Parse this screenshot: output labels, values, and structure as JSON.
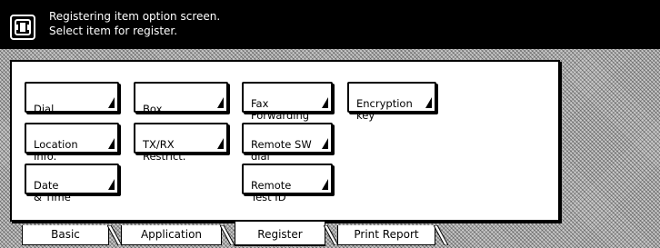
{
  "header": {
    "line1": "Registering item option screen.",
    "line2": "Select item for register.",
    "icon": "fax-machine-icon"
  },
  "buttons": {
    "dial": "Dial",
    "box": "Box",
    "fax_forwarding": "Fax\nForwarding",
    "encryption_key": "Encryption\nkey",
    "location_info": "Location\nInfo.",
    "txrx_restrict": "TX/RX\nRestrict.",
    "remote_sw_dial": "Remote SW\ndial",
    "date_time": "Date\n& Time",
    "remote_test_id": "Remote\nTest ID"
  },
  "tabs": {
    "basic": "Basic",
    "application": "Application",
    "register": "Register",
    "print_report": "Print Report",
    "active": "Register"
  },
  "colors": {
    "background": "#000000",
    "panel": "#ffffff",
    "hatch": "#c8c8c8"
  }
}
